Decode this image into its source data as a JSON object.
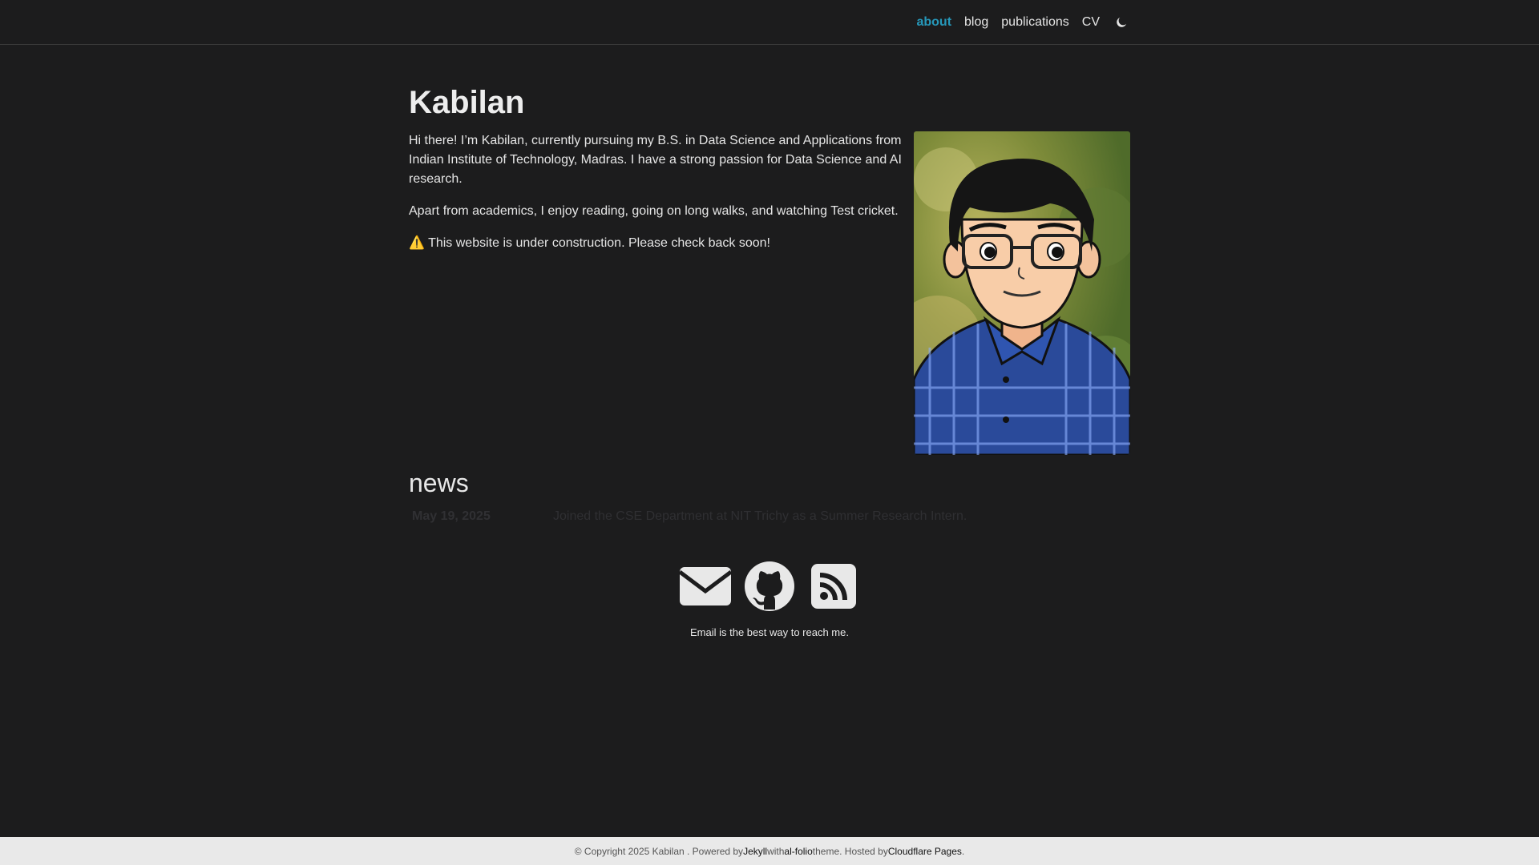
{
  "nav": {
    "items": [
      {
        "label": "about",
        "active": true
      },
      {
        "label": "blog",
        "active": false
      },
      {
        "label": "publications",
        "active": false
      },
      {
        "label": "CV",
        "active": false
      }
    ],
    "theme_icon": "moon-icon",
    "accent_color": "#2698ba"
  },
  "main": {
    "title": "Kabilan",
    "paragraphs": [
      "Hi there! I’m Kabilan, currently pursuing my B.S. in Data Science and Applications from Indian Institute of Technology, Madras. I have a strong passion for Data Science and AI research.",
      "Apart from academics, I enjoy reading, going on long walks, and watching Test cricket.",
      "⚠️ This website is under construction. Please check back soon!"
    ]
  },
  "news": {
    "heading": "news",
    "items": [
      {
        "date": "May 19, 2025",
        "text": "Joined the CSE Department at NIT Trichy as a Summer Research Intern."
      }
    ]
  },
  "social": {
    "icons": [
      "envelope-icon",
      "github-icon",
      "rss-icon"
    ],
    "note": "Email is the best way to reach me."
  },
  "footer": {
    "prefix": "© Copyright 2025 Kabilan . Powered by ",
    "jekyll": "Jekyll",
    "with": " with ",
    "alfolio": "al-folio",
    "theme": " theme. Hosted by ",
    "host": "Cloudflare Pages",
    "suffix": "."
  }
}
